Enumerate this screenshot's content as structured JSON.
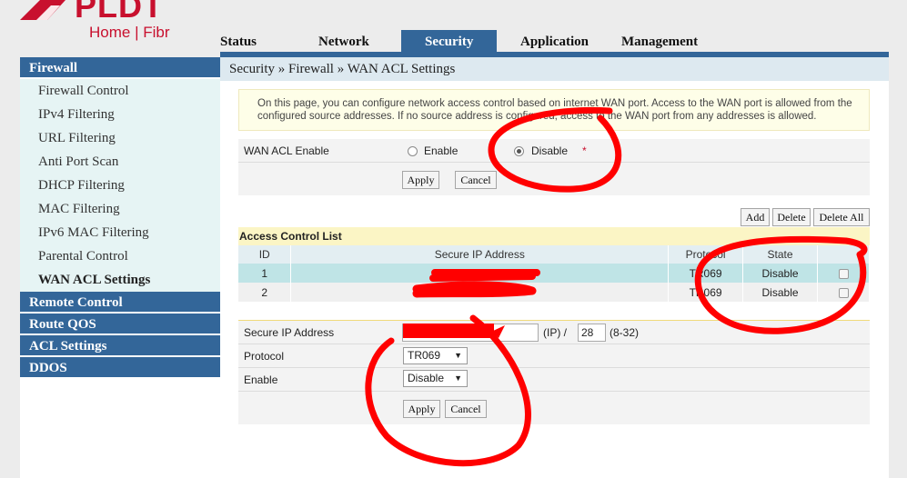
{
  "brand": {
    "name": "PLDT",
    "subtitle": "Home | Fibr"
  },
  "topnav": {
    "tabs": [
      "Status",
      "Network",
      "Security",
      "Application",
      "Management"
    ],
    "active": "Security"
  },
  "sidebar": {
    "section_firewall": "Firewall",
    "items": [
      "Firewall Control",
      "IPv4 Filtering",
      "URL Filtering",
      "Anti Port Scan",
      "DHCP Filtering",
      "MAC Filtering",
      "IPv6 MAC Filtering",
      "Parental Control",
      "WAN ACL Settings"
    ],
    "active_item": "WAN ACL Settings",
    "sections": [
      "Remote Control",
      "Route QOS",
      "ACL Settings",
      "DDOS"
    ]
  },
  "breadcrumb": "Security » Firewall » WAN ACL Settings",
  "info_text": "On this page, you can configure network access control based on internet WAN port. Access to the WAN port is allowed from the configured source addresses. If no source address is configured, access to the WAN port from any addresses is allowed.",
  "wan_acl": {
    "label": "WAN ACL Enable",
    "enable_label": "Enable",
    "disable_label": "Disable",
    "required_mark": "*",
    "selected": "Disable",
    "apply_label": "Apply",
    "cancel_label": "Cancel"
  },
  "acl_table": {
    "add_label": "Add",
    "delete_label": "Delete",
    "delete_all_label": "Delete All",
    "title": "Access Control List",
    "columns": [
      "ID",
      "Secure IP Address",
      "Protocol",
      "State"
    ],
    "rows": [
      {
        "id": "1",
        "ip": "",
        "protocol": "TR069",
        "state": "Disable"
      },
      {
        "id": "2",
        "ip": "",
        "protocol": "TR069",
        "state": "Disable"
      }
    ]
  },
  "entry_form": {
    "ip_label": "Secure IP Address",
    "ip_value": "",
    "ip_suffix": "(IP) /",
    "mask_value": "28",
    "mask_hint": "(8-32)",
    "protocol_label": "Protocol",
    "protocol_value": "TR069",
    "enable_label": "Enable",
    "enable_value": "Disable",
    "apply_label": "Apply",
    "cancel_label": "Cancel"
  },
  "colors": {
    "accent": "#336699",
    "brand": "#c8102e",
    "annotation": "#ff0000"
  }
}
